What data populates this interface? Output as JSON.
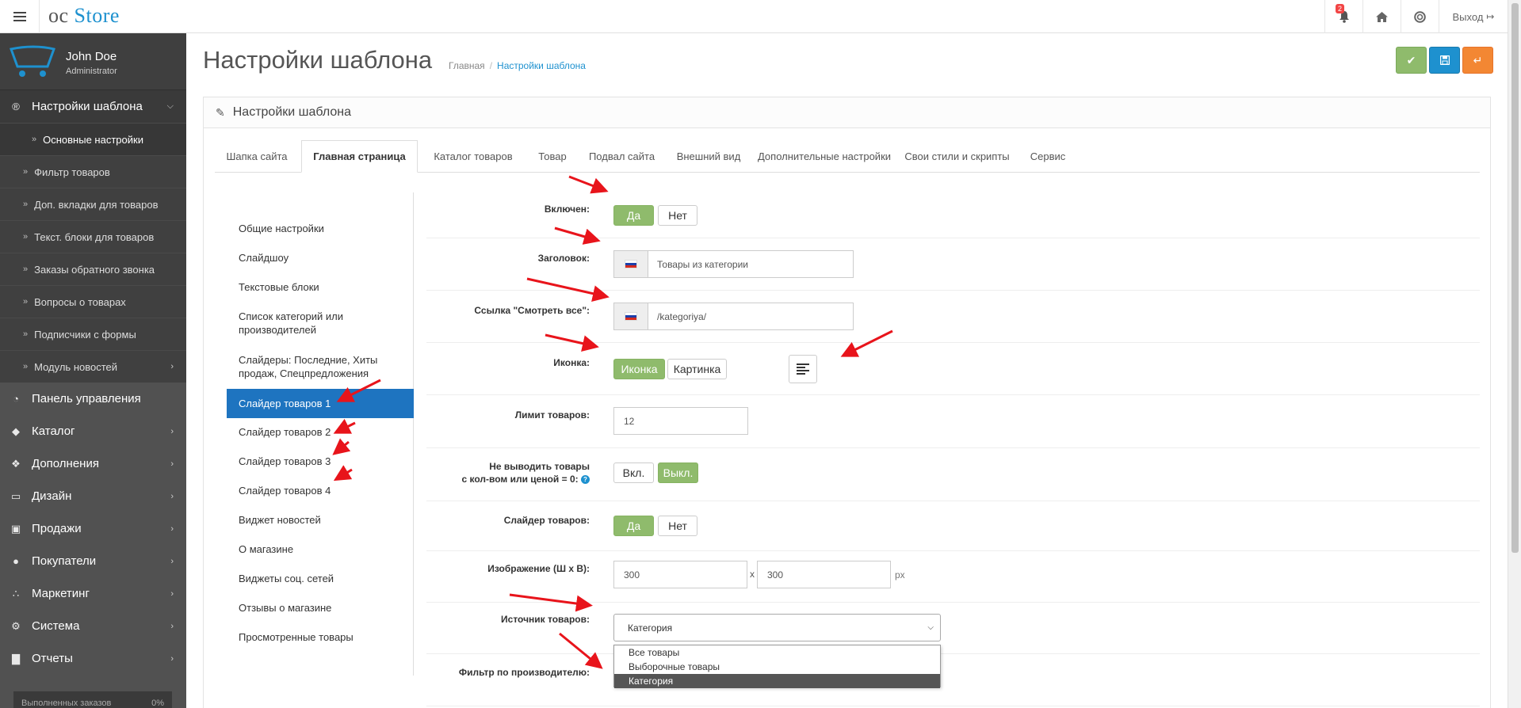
{
  "header": {
    "logo_oc": "oc",
    "logo_store": "Store",
    "notifications_count": "2",
    "logout_label": "Выход"
  },
  "sidebar": {
    "user_name": "John Doe",
    "user_role": "Administrator",
    "active_section": "Настройки шаблона",
    "sub_items": [
      "Основные настройки",
      "Фильтр товаров",
      "Доп. вкладки для товаров",
      "Текст. блоки для товаров",
      "Заказы обратного звонка",
      "Вопросы о товарах",
      "Подписчики с формы",
      "Модуль новостей"
    ],
    "nav_items": [
      {
        "label": "Панель управления",
        "icon": "dashboard-icon"
      },
      {
        "label": "Каталог",
        "icon": "tag-icon"
      },
      {
        "label": "Дополнения",
        "icon": "puzzle-icon"
      },
      {
        "label": "Дизайн",
        "icon": "monitor-icon"
      },
      {
        "label": "Продажи",
        "icon": "cart-icon"
      },
      {
        "label": "Покупатели",
        "icon": "user-icon"
      },
      {
        "label": "Маркетинг",
        "icon": "share-icon"
      },
      {
        "label": "Система",
        "icon": "gear-icon"
      },
      {
        "label": "Отчеты",
        "icon": "bar-chart-icon"
      }
    ],
    "stat_label": "Выполненных заказов",
    "stat_value": "0%"
  },
  "page": {
    "title": "Настройки шаблона",
    "breadcrumb_home": "Главная",
    "breadcrumb_current": "Настройки шаблона",
    "panel_title": "Настройки шаблона"
  },
  "colors": {
    "accent": "#1e91cf",
    "success": "#8fbb6c",
    "warning": "#f38733",
    "sidebar_bg": "#515151",
    "active_subnav": "#1e74c0",
    "arrow": "#e8141b"
  },
  "tabs": [
    "Шапка сайта",
    "Главная страница",
    "Каталог товаров",
    "Товар",
    "Подвал сайта",
    "Внешний вид",
    "Дополнительные настройки",
    "Свои стили и скрипты",
    "Сервис"
  ],
  "subnav": [
    "Общие настройки",
    "Слайдшоу",
    "Текстовые блоки",
    "Список категорий или производителей",
    "Слайдеры: Последние, Хиты продаж, Спецпредложения",
    "Слайдер товаров 1",
    "Слайдер товаров 2",
    "Слайдер товаров 3",
    "Слайдер товаров 4",
    "Виджет новостей",
    "О магазине",
    "Виджеты соц. сетей",
    "Отзывы о магазине",
    "Просмотренные товары"
  ],
  "form": {
    "enabled_label": "Включен:",
    "yes": "Да",
    "no": "Нет",
    "heading_label": "Заголовок:",
    "heading_value": "Товары из категории",
    "link_label": "Ссылка \"Смотреть все\":",
    "link_value": "/kategoriya/",
    "icon_label": "Иконка:",
    "icon_option": "Иконка",
    "image_option": "Картинка",
    "limit_label": "Лимит товаров:",
    "limit_value": "12",
    "hide_zero_label_1": "Не выводить товары",
    "hide_zero_label_2": "с кол-вом или ценой = 0:",
    "on": "Вкл.",
    "off": "Выкл.",
    "slider_label": "Слайдер товаров:",
    "image_size_label": "Изображение (Ш х В):",
    "width_value": "300",
    "height_value": "300",
    "x_sep": "x",
    "px_unit": "px",
    "source_label": "Источник товаров:",
    "source_value": "Категория",
    "source_options": [
      "Все товары",
      "Выборочные товары",
      "Категория"
    ],
    "manufacturer_filter_label": "Фильтр по производителю:"
  }
}
